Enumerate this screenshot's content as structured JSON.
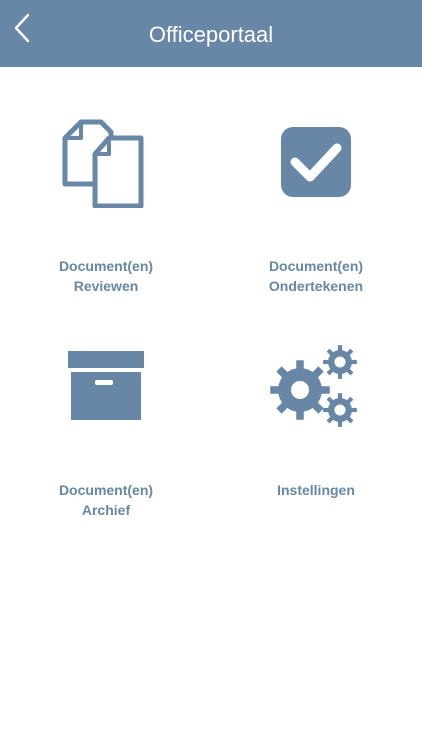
{
  "header": {
    "title": "Officeportaal",
    "back_icon": "chevron-left-icon"
  },
  "colors": {
    "accent": "#6887a6",
    "background": "#ffffff",
    "header_text": "#ffffff"
  },
  "tiles": [
    {
      "line1": "Document(en)",
      "line2": "Reviewen",
      "icon": "documents-icon"
    },
    {
      "line1": "Document(en)",
      "line2": "Ondertekenen",
      "icon": "checkbox-checked-icon"
    },
    {
      "line1": "Document(en)",
      "line2": "Archief",
      "icon": "archive-box-icon"
    },
    {
      "line1": "Instellingen",
      "line2": "",
      "icon": "gears-icon"
    }
  ]
}
